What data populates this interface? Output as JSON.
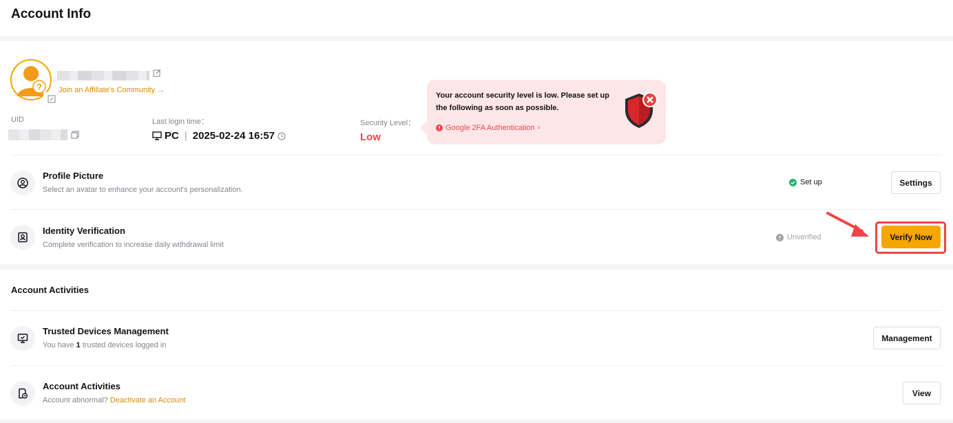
{
  "header": {
    "title": "Account Info"
  },
  "profile": {
    "affiliate_link": "Join an Affiliate's Community",
    "affiliate_arrow": "→",
    "uid_label": "UID",
    "last_login_label": "Last login time：",
    "last_login_device": "PC",
    "last_login_sep": "|",
    "last_login_time": "2025-02-24 16:57",
    "security_label": "Security Level：",
    "security_value": "Low"
  },
  "security_tooltip": {
    "message": "Your account security level is low. Please set up the following as soon as possible.",
    "link": "Google 2FA Authentication",
    "link_chevron": "›"
  },
  "rows": [
    {
      "title": "Profile Picture",
      "desc": "Select an avatar to enhance your account's personalization.",
      "status": "Set up",
      "button": "Settings"
    },
    {
      "title": "Identity Verification",
      "desc": "Complete verification to increase daily withdrawal limit",
      "status": "Unverified",
      "button": "Verify Now"
    }
  ],
  "activities": {
    "section_title": "Account Activities",
    "trusted": {
      "title": "Trusted Devices Management",
      "desc_pre": "You have ",
      "desc_count": "1",
      "desc_post": " trusted devices logged in",
      "button": "Management"
    },
    "account": {
      "title": "Account Activities",
      "desc_pre": "Account abnormal? ",
      "desc_link": "Deactivate an Account",
      "button": "View"
    }
  },
  "colors": {
    "accent": "#f7a600",
    "danger": "#ef454a",
    "success": "#20b26c",
    "muted": "#81858c"
  }
}
